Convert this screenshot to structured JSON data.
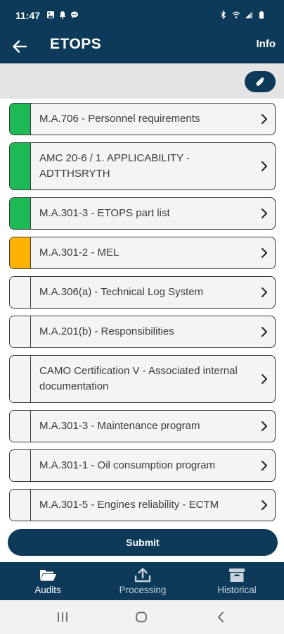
{
  "status_bar": {
    "time": "11:47",
    "left_icons": [
      "image-icon",
      "notification-icon",
      "message-icon"
    ],
    "right_icons": [
      "bluetooth-icon",
      "wifi-icon",
      "signal-icon",
      "battery-icon"
    ]
  },
  "header": {
    "title": "ETOPS",
    "info_label": "Info"
  },
  "colors": {
    "primary": "#0d3a58",
    "status_green": "#1db954",
    "status_orange": "#ffb300",
    "status_none": "#f4f4f4"
  },
  "items": [
    {
      "label": "M.A.706 - Personnel requirements",
      "status": "green"
    },
    {
      "label": "AMC 20-6 / 1. APPLICABILITY - ADTTHSRYTH",
      "status": "green"
    },
    {
      "label": "M.A.301-3 - ETOPS part list",
      "status": "green"
    },
    {
      "label": "M.A.301-2 - MEL",
      "status": "orange"
    },
    {
      "label": "M.A.306(a) - Technical Log System",
      "status": "none"
    },
    {
      "label": "M.A.201(b) - Responsibilities",
      "status": "none"
    },
    {
      "label": "CAMO Certification V - Associated internal documentation",
      "status": "none"
    },
    {
      "label": "M.A.301-3 - Maintenance program",
      "status": "none"
    },
    {
      "label": "M.A.301-1 - Oil consumption program",
      "status": "none"
    },
    {
      "label": "M.A.301-5 - Engines reliability - ECTM",
      "status": "none"
    }
  ],
  "submit_label": "Submit",
  "bottom_nav": {
    "tabs": [
      {
        "label": "Audits",
        "icon": "folder-open-icon",
        "active": true
      },
      {
        "label": "Processing",
        "icon": "upload-icon",
        "active": false
      },
      {
        "label": "Historical",
        "icon": "archive-icon",
        "active": false
      }
    ]
  }
}
